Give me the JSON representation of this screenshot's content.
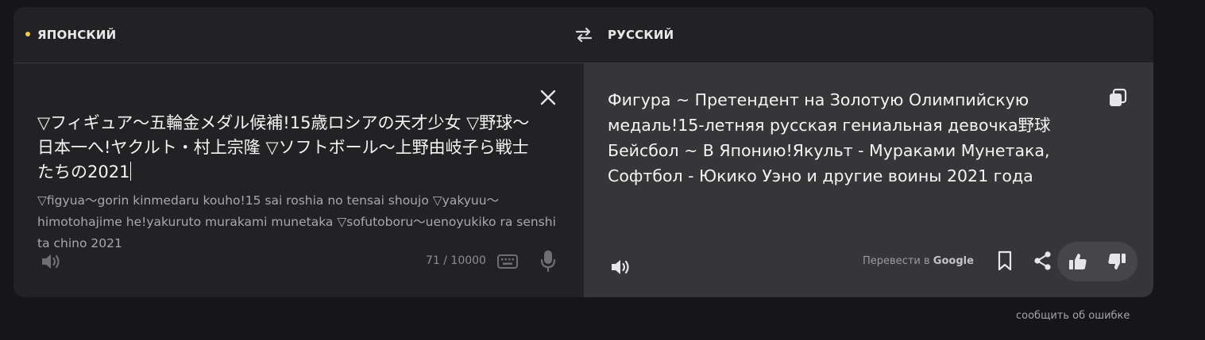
{
  "header": {
    "source_language": "ЯПОНСКИЙ",
    "target_language": "РУССКИЙ",
    "active_dot_color": "#f0c94b"
  },
  "source": {
    "text": "▽フィギュア〜五輪金メダル候補!15歳ロシアの天才少女 ▽野球〜日本一へ!ヤクルト・村上宗隆 ▽ソフトボール〜上野由岐子ら戦士たちの2021",
    "transliteration": "▽figyua〜gorin kinmedaru kouho!15 sai roshia no tensai shoujo ▽yakyuu〜himotohajime he!yakuruto murakami munetaka ▽sofutoboru〜uenoyukiko ra senshi ta chino 2021",
    "char_counter": "71 / 10000"
  },
  "target": {
    "text": "Фигура ~ Претендент на Золотую Олимпийскую медаль!15-летняя русская гениальная девочка野球 Бейсбол ~ В Японию!Якульт - Мураками Мунетака, Софтбол - Юкико Уэно и другие воины 2021 года",
    "via_prefix": "Перевести в",
    "via_brand": "Google"
  },
  "footer": {
    "report_error": "сообщить об ошибке"
  },
  "icons": {
    "swap": "swap-arrows-icon",
    "close": "close-icon",
    "copy": "copy-icon",
    "speaker": "speaker-icon",
    "keyboard": "keyboard-icon",
    "microphone": "microphone-icon",
    "bookmark": "bookmark-icon",
    "share": "share-icon",
    "like": "thumbs-up-icon",
    "dislike": "thumbs-down-icon"
  }
}
